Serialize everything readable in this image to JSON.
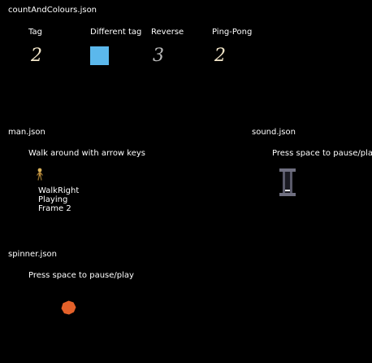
{
  "colors": {
    "background": "#000000",
    "text": "#ffffff",
    "tag_square": "#5bb8ec",
    "spinner": "#e4612a"
  },
  "count_and_colours": {
    "title": "countAndColours.json",
    "labels": {
      "tag": "Tag",
      "different_tag": "Different tag",
      "reverse": "Reverse",
      "ping_pong": "Ping-Pong"
    },
    "digits": {
      "tag": "2",
      "reverse": "3",
      "ping_pong": "2"
    }
  },
  "man": {
    "title": "man.json",
    "instruction": "Walk around with arrow keys",
    "status": {
      "animation": "WalkRight",
      "state": "Playing",
      "frame": "Frame 2"
    }
  },
  "sound": {
    "title": "sound.json",
    "instruction": "Press space to pause/play"
  },
  "spinner": {
    "title": "spinner.json",
    "instruction": "Press space to pause/play"
  }
}
